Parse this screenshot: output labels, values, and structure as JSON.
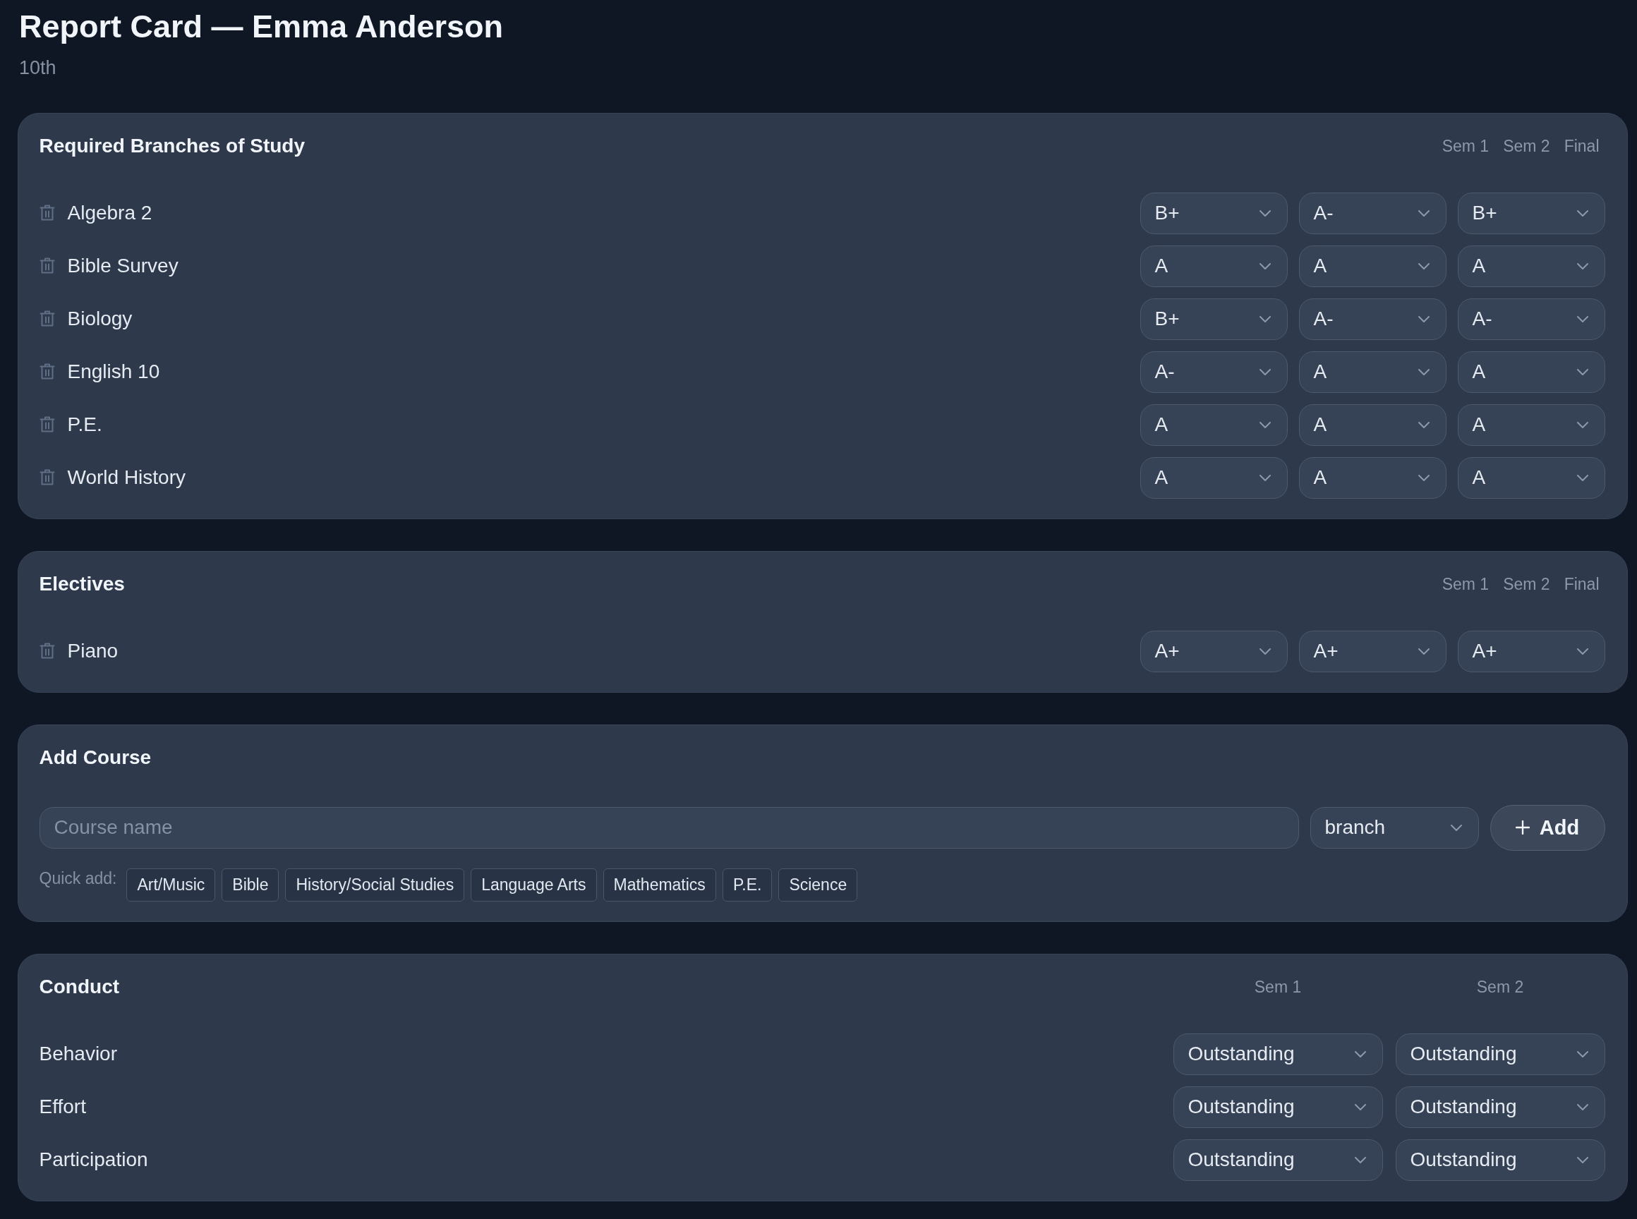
{
  "header": {
    "title": "Report Card — Emma Anderson",
    "subtitle": "10th"
  },
  "sections": [
    {
      "kind": "courses",
      "title": "Required Branches of Study",
      "columns": [
        "Sem 1",
        "Sem 2",
        "Final"
      ],
      "rows": [
        {
          "name": "Algebra 2",
          "grades": [
            "B+",
            "A-",
            "B+"
          ]
        },
        {
          "name": "Bible Survey",
          "grades": [
            "A",
            "A",
            "A"
          ]
        },
        {
          "name": "Biology",
          "grades": [
            "B+",
            "A-",
            "A-"
          ]
        },
        {
          "name": "English 10",
          "grades": [
            "A-",
            "A",
            "A"
          ]
        },
        {
          "name": "P.E.",
          "grades": [
            "A",
            "A",
            "A"
          ]
        },
        {
          "name": "World History",
          "grades": [
            "A",
            "A",
            "A"
          ]
        }
      ]
    },
    {
      "kind": "courses",
      "title": "Electives",
      "columns": [
        "Sem 1",
        "Sem 2",
        "Final"
      ],
      "rows": [
        {
          "name": "Piano",
          "grades": [
            "A+",
            "A+",
            "A+"
          ]
        }
      ]
    },
    {
      "kind": "add_course",
      "title": "Add Course",
      "course_name": {
        "placeholder": "Course name"
      },
      "branch_select": {
        "value": "branch"
      },
      "add_button": {
        "label": "Add"
      },
      "quick_add": {
        "label": "Quick add:",
        "options": [
          "Art/Music",
          "Bible",
          "History/Social Studies",
          "Language Arts",
          "Mathematics",
          "P.E.",
          "Science"
        ]
      }
    },
    {
      "kind": "conduct",
      "title": "Conduct",
      "columns": [
        "Sem 1",
        "Sem 2"
      ],
      "rows": [
        {
          "name": "Behavior",
          "ratings": [
            "Outstanding",
            "Outstanding"
          ]
        },
        {
          "name": "Effort",
          "ratings": [
            "Outstanding",
            "Outstanding"
          ]
        },
        {
          "name": "Participation",
          "ratings": [
            "Outstanding",
            "Outstanding"
          ]
        }
      ]
    }
  ]
}
